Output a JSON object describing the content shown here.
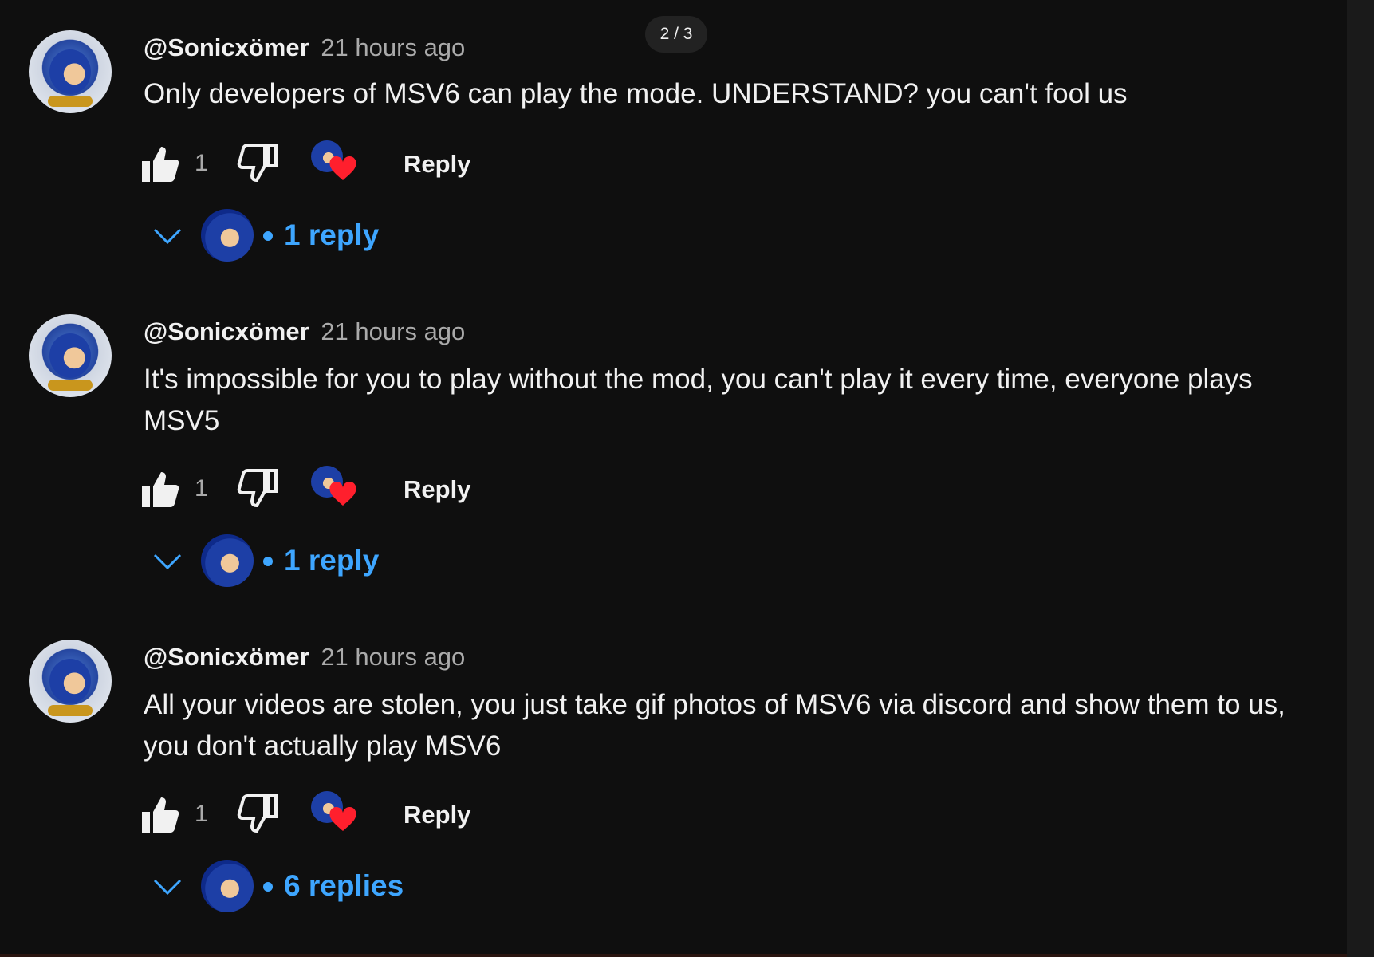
{
  "pager": {
    "label": "2 / 3"
  },
  "comments": [
    {
      "author": "@Sonicxömer",
      "time": "21 hours ago",
      "text": "Only developers of MSV6 can play the mode. UNDERSTAND? you can't fool us",
      "likes": "1",
      "reply_label": "Reply",
      "replies_label": "1 reply"
    },
    {
      "author": "@Sonicxömer",
      "time": "21 hours ago",
      "text": "It's impossible for you to play without the mod, you can't play it every time, everyone plays MSV5",
      "likes": "1",
      "reply_label": "Reply",
      "replies_label": "1 reply"
    },
    {
      "author": "@Sonicxömer",
      "time": "21 hours ago",
      "text": "All your videos are stolen, you just take gif photos of MSV6 via discord and show them to us, you don't actually play MSV6",
      "likes": "1",
      "reply_label": "Reply",
      "replies_label": "6 replies"
    }
  ],
  "colors": {
    "background": "#0f0f0f",
    "link": "#3ea6ff",
    "heart": "#ff1f2d"
  }
}
